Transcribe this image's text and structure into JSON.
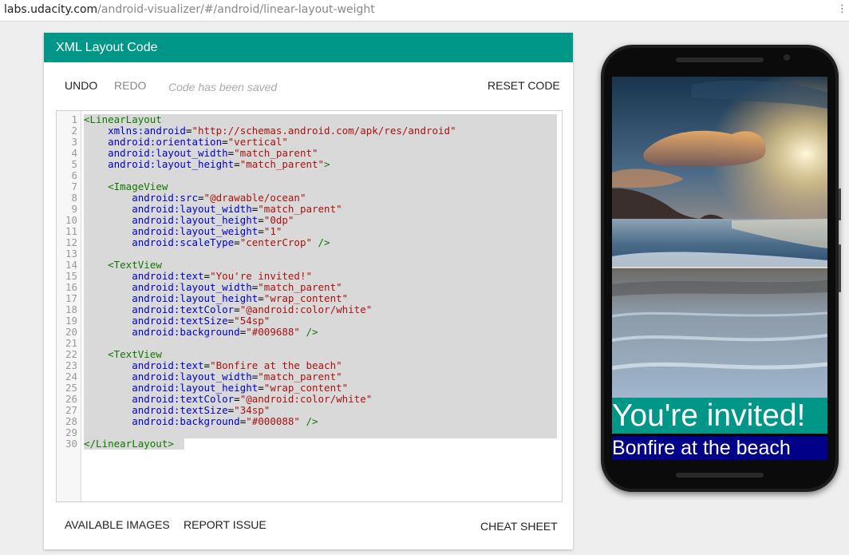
{
  "browser": {
    "url_host": "labs.udacity.com",
    "url_path": "/android-visualizer/#/android/linear-layout-weight"
  },
  "editor": {
    "title": "XML Layout Code",
    "undo_label": "UNDO",
    "redo_label": "REDO",
    "status_text": "Code has been saved",
    "reset_label": "RESET CODE",
    "line_numbers": [
      "1",
      "2",
      "3",
      "4",
      "5",
      "6",
      "7",
      "8",
      "9",
      "10",
      "11",
      "12",
      "13",
      "14",
      "15",
      "16",
      "17",
      "18",
      "19",
      "20",
      "21",
      "22",
      "23",
      "24",
      "25",
      "26",
      "27",
      "28",
      "29",
      "30"
    ],
    "lines": [
      [
        {
          "t": "tag",
          "v": "<LinearLayout"
        }
      ],
      [
        {
          "t": "plain",
          "v": "    "
        },
        {
          "t": "attr",
          "v": "xmlns:android"
        },
        {
          "t": "plain",
          "v": "="
        },
        {
          "t": "str",
          "v": "\"http://schemas.android.com/apk/res/android\""
        }
      ],
      [
        {
          "t": "plain",
          "v": "    "
        },
        {
          "t": "attr",
          "v": "android:orientation"
        },
        {
          "t": "plain",
          "v": "="
        },
        {
          "t": "str",
          "v": "\"vertical\""
        }
      ],
      [
        {
          "t": "plain",
          "v": "    "
        },
        {
          "t": "attr",
          "v": "android:layout_width"
        },
        {
          "t": "plain",
          "v": "="
        },
        {
          "t": "str",
          "v": "\"match_parent\""
        }
      ],
      [
        {
          "t": "plain",
          "v": "    "
        },
        {
          "t": "attr",
          "v": "android:layout_height"
        },
        {
          "t": "plain",
          "v": "="
        },
        {
          "t": "str",
          "v": "\"match_parent\""
        },
        {
          "t": "tag",
          "v": ">"
        }
      ],
      [],
      [
        {
          "t": "plain",
          "v": "    "
        },
        {
          "t": "tag",
          "v": "<ImageView"
        }
      ],
      [
        {
          "t": "plain",
          "v": "        "
        },
        {
          "t": "attr",
          "v": "android:src"
        },
        {
          "t": "plain",
          "v": "="
        },
        {
          "t": "str",
          "v": "\"@drawable/ocean\""
        }
      ],
      [
        {
          "t": "plain",
          "v": "        "
        },
        {
          "t": "attr",
          "v": "android:layout_width"
        },
        {
          "t": "plain",
          "v": "="
        },
        {
          "t": "str",
          "v": "\"match_parent\""
        }
      ],
      [
        {
          "t": "plain",
          "v": "        "
        },
        {
          "t": "attr",
          "v": "android:layout_height"
        },
        {
          "t": "plain",
          "v": "="
        },
        {
          "t": "str",
          "v": "\"0dp\""
        }
      ],
      [
        {
          "t": "plain",
          "v": "        "
        },
        {
          "t": "attr",
          "v": "android:layout_weight"
        },
        {
          "t": "plain",
          "v": "="
        },
        {
          "t": "str",
          "v": "\"1\""
        }
      ],
      [
        {
          "t": "plain",
          "v": "        "
        },
        {
          "t": "attr",
          "v": "android:scaleType"
        },
        {
          "t": "plain",
          "v": "="
        },
        {
          "t": "str",
          "v": "\"centerCrop\""
        },
        {
          "t": "plain",
          "v": " "
        },
        {
          "t": "tag",
          "v": "/>"
        }
      ],
      [],
      [
        {
          "t": "plain",
          "v": "    "
        },
        {
          "t": "tag",
          "v": "<TextView"
        }
      ],
      [
        {
          "t": "plain",
          "v": "        "
        },
        {
          "t": "attr",
          "v": "android:text"
        },
        {
          "t": "plain",
          "v": "="
        },
        {
          "t": "str",
          "v": "\"You're invited!\""
        }
      ],
      [
        {
          "t": "plain",
          "v": "        "
        },
        {
          "t": "attr",
          "v": "android:layout_width"
        },
        {
          "t": "plain",
          "v": "="
        },
        {
          "t": "str",
          "v": "\"match_parent\""
        }
      ],
      [
        {
          "t": "plain",
          "v": "        "
        },
        {
          "t": "attr",
          "v": "android:layout_height"
        },
        {
          "t": "plain",
          "v": "="
        },
        {
          "t": "str",
          "v": "\"wrap_content\""
        }
      ],
      [
        {
          "t": "plain",
          "v": "        "
        },
        {
          "t": "attr",
          "v": "android:textColor"
        },
        {
          "t": "plain",
          "v": "="
        },
        {
          "t": "str",
          "v": "\"@android:color/white\""
        }
      ],
      [
        {
          "t": "plain",
          "v": "        "
        },
        {
          "t": "attr",
          "v": "android:textSize"
        },
        {
          "t": "plain",
          "v": "="
        },
        {
          "t": "str",
          "v": "\"54sp\""
        }
      ],
      [
        {
          "t": "plain",
          "v": "        "
        },
        {
          "t": "attr",
          "v": "android:background"
        },
        {
          "t": "plain",
          "v": "="
        },
        {
          "t": "str",
          "v": "\"#009688\""
        },
        {
          "t": "plain",
          "v": " "
        },
        {
          "t": "tag",
          "v": "/>"
        }
      ],
      [],
      [
        {
          "t": "plain",
          "v": "    "
        },
        {
          "t": "tag",
          "v": "<TextView"
        }
      ],
      [
        {
          "t": "plain",
          "v": "        "
        },
        {
          "t": "attr",
          "v": "android:text"
        },
        {
          "t": "plain",
          "v": "="
        },
        {
          "t": "str",
          "v": "\"Bonfire at the beach\""
        }
      ],
      [
        {
          "t": "plain",
          "v": "        "
        },
        {
          "t": "attr",
          "v": "android:layout_width"
        },
        {
          "t": "plain",
          "v": "="
        },
        {
          "t": "str",
          "v": "\"match_parent\""
        }
      ],
      [
        {
          "t": "plain",
          "v": "        "
        },
        {
          "t": "attr",
          "v": "android:layout_height"
        },
        {
          "t": "plain",
          "v": "="
        },
        {
          "t": "str",
          "v": "\"wrap_content\""
        }
      ],
      [
        {
          "t": "plain",
          "v": "        "
        },
        {
          "t": "attr",
          "v": "android:textColor"
        },
        {
          "t": "plain",
          "v": "="
        },
        {
          "t": "str",
          "v": "\"@android:color/white\""
        }
      ],
      [
        {
          "t": "plain",
          "v": "        "
        },
        {
          "t": "attr",
          "v": "android:textSize"
        },
        {
          "t": "plain",
          "v": "="
        },
        {
          "t": "str",
          "v": "\"34sp\""
        }
      ],
      [
        {
          "t": "plain",
          "v": "        "
        },
        {
          "t": "attr",
          "v": "android:background"
        },
        {
          "t": "plain",
          "v": "="
        },
        {
          "t": "str",
          "v": "\"#000088\""
        },
        {
          "t": "plain",
          "v": " "
        },
        {
          "t": "tag",
          "v": "/>"
        }
      ],
      [],
      [
        {
          "t": "tag",
          "v": "</LinearLayout>"
        }
      ]
    ],
    "footer": {
      "available_images_label": "AVAILABLE IMAGES",
      "report_issue_label": "REPORT ISSUE",
      "cheat_sheet_label": "CHEAT SHEET"
    },
    "colors": {
      "header": "#009688",
      "tag": "#117700",
      "attr": "#0000cc",
      "string": "#aa1111"
    }
  },
  "preview": {
    "image_name": "ocean",
    "invite_text": "You're invited!",
    "invite_bg": "#009688",
    "bonfire_text": "Bonfire at the beach",
    "bonfire_bg": "#000088"
  }
}
